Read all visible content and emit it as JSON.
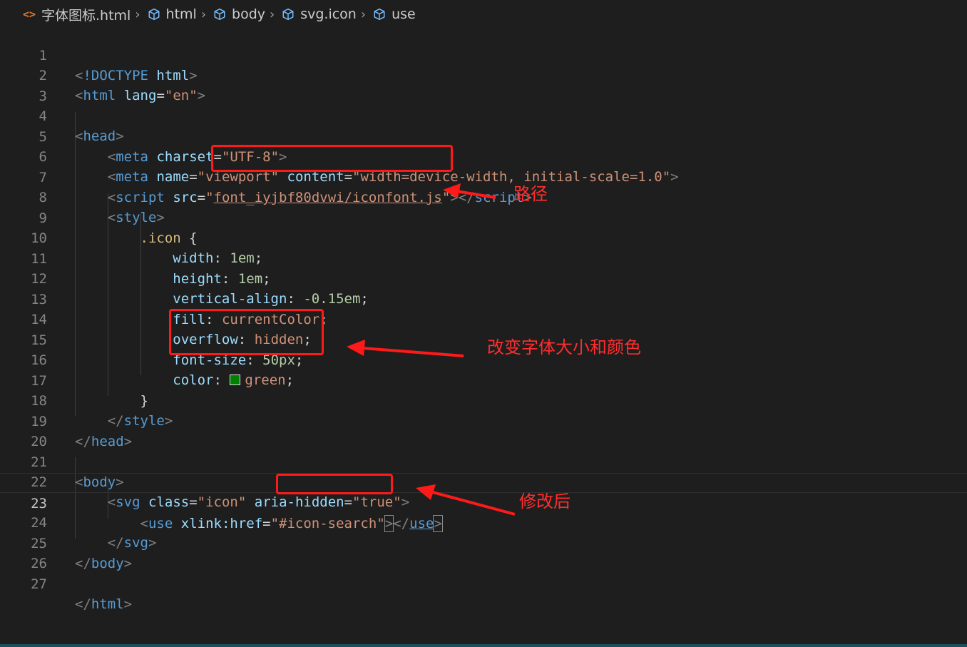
{
  "breadcrumb": {
    "file_icon": "<>",
    "items": [
      "字体图标.html",
      "html",
      "body",
      "svg.icon",
      "use"
    ]
  },
  "lines": [
    {
      "n": "1"
    },
    {
      "n": "2"
    },
    {
      "n": "3"
    },
    {
      "n": "4"
    },
    {
      "n": "5"
    },
    {
      "n": "6"
    },
    {
      "n": "7"
    },
    {
      "n": "8"
    },
    {
      "n": "9"
    },
    {
      "n": "10"
    },
    {
      "n": "11"
    },
    {
      "n": "12"
    },
    {
      "n": "13"
    },
    {
      "n": "14"
    },
    {
      "n": "15"
    },
    {
      "n": "16"
    },
    {
      "n": "17"
    },
    {
      "n": "18"
    },
    {
      "n": "19"
    },
    {
      "n": "20"
    },
    {
      "n": "21"
    },
    {
      "n": "22"
    },
    {
      "n": "23"
    },
    {
      "n": "24"
    },
    {
      "n": "25"
    },
    {
      "n": "26"
    },
    {
      "n": "27"
    }
  ],
  "code": {
    "doctype": "!DOCTYPE",
    "html": "html",
    "lang_attr": "lang",
    "lang_val": "\"en\"",
    "head": "head",
    "meta": "meta",
    "charset_attr": "charset",
    "charset_val": "\"UTF-8\"",
    "name_attr": "name",
    "name_val": "\"viewport\"",
    "content_attr": "content",
    "content_val": "\"width=device-width, initial-scale=1.0\"",
    "script": "script",
    "src_attr": "src",
    "src_val": "font_iyjbf80dvwi/iconfont.js",
    "style": "style",
    "selector": ".icon",
    "width_prop": "width",
    "width_val": "1em",
    "height_prop": "height",
    "height_val": "1em",
    "valign_prop": "vertical-align",
    "valign_val": "-0.15em",
    "fill_prop": "fill",
    "fill_val": "currentColor",
    "overflow_prop": "overflow",
    "overflow_val": "hidden",
    "fontsize_prop": "font-size",
    "fontsize_val": "50px",
    "color_prop": "color",
    "color_val": "green",
    "body": "body",
    "svg": "svg",
    "class_attr": "class",
    "class_val": "\"icon\"",
    "aria_attr": "aria-hidden",
    "aria_val": "\"true\"",
    "use": "use",
    "href_attr": "xlink:href",
    "href_val": "#icon-search"
  },
  "annotations": {
    "path_note": "路径",
    "font_note": "改变字体大小和颜色",
    "modified_note": "修改后"
  },
  "colors": {
    "background": "#1e1e1e",
    "annotation": "#ff1a1a",
    "swatch": "#008000"
  }
}
